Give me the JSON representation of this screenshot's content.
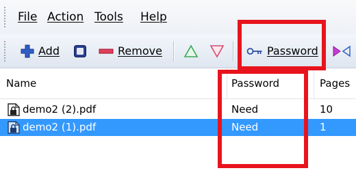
{
  "menu": {
    "file": "File",
    "action": "Action",
    "tools": "Tools",
    "help": "Help"
  },
  "toolbar": {
    "add_label": "Add",
    "remove_label": "Remove",
    "password_label": "Password"
  },
  "table": {
    "columns": [
      "Name",
      "Password",
      "Pages"
    ],
    "rows": [
      {
        "name": "demo2 (2).pdf",
        "password": "Need",
        "pages": "10"
      },
      {
        "name": "demo2 (1).pdf",
        "password": "Need",
        "pages": "1"
      }
    ]
  },
  "colors": {
    "highlight_box": "#e8141d",
    "selection": "#3399ff"
  }
}
